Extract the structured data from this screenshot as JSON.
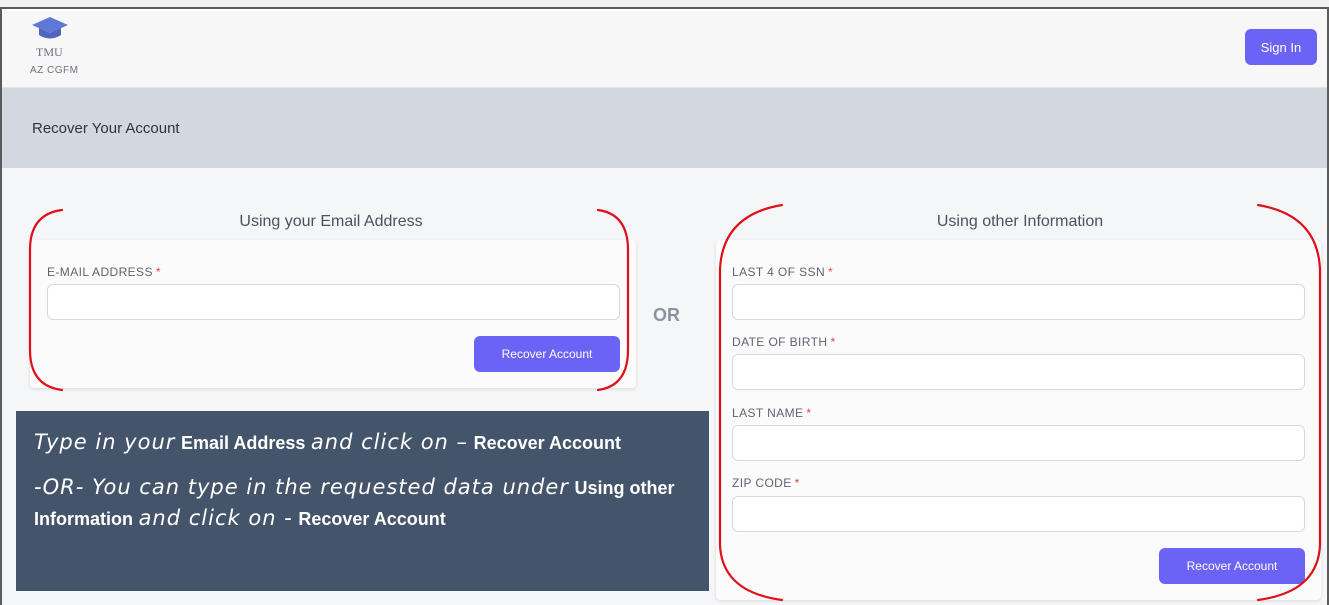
{
  "header": {
    "logo_name": "TMU",
    "logo_subtitle": "AZ CGFM",
    "signin_label": "Sign In"
  },
  "page": {
    "title": "Recover Your Account"
  },
  "email_section": {
    "title": "Using your Email Address",
    "email_label": "E-MAIL ADDRESS",
    "email_value": "",
    "button_label": "Recover Account"
  },
  "or_label": "OR",
  "other_section": {
    "title": "Using other Information",
    "fields": [
      {
        "label": "LAST 4 OF SSN",
        "value": ""
      },
      {
        "label": "DATE OF BIRTH",
        "value": ""
      },
      {
        "label": "LAST NAME",
        "value": ""
      },
      {
        "label": "ZIP CODE",
        "value": ""
      }
    ],
    "button_label": "Recover Account"
  },
  "required_marker": "*",
  "instruction": {
    "line1_italic_a": "Type in your",
    "line1_bold_a": "Email Address",
    "line1_italic_b": "and click on –",
    "line1_bold_b": "Recover Account",
    "line2_italic_a": "-OR- You can type in the requested data under",
    "line2_bold_a": "Using other Information",
    "line2_italic_b": "and click on -",
    "line2_bold_b": "Recover Account"
  },
  "colors": {
    "accent": "#6b63f5",
    "title_band": "#d3d7df",
    "required": "#e0444f",
    "annotation_red": "#e0101a",
    "instruction_bg": "#44546a"
  },
  "icons": {
    "logo": "graduation-cap-icon"
  }
}
